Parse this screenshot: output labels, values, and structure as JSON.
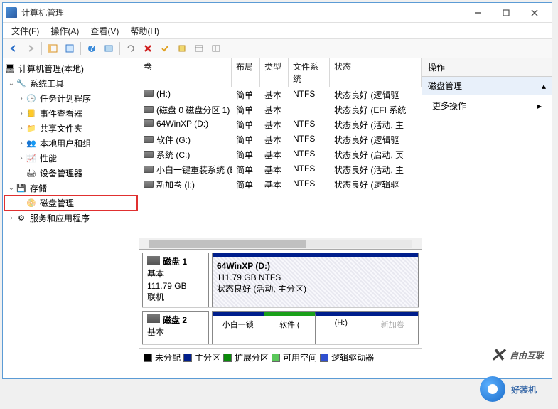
{
  "window": {
    "title": "计算机管理"
  },
  "menu": {
    "file": "文件(F)",
    "action": "操作(A)",
    "view": "查看(V)",
    "help": "帮助(H)"
  },
  "tree": {
    "root": "计算机管理(本地)",
    "sys_tools": "系统工具",
    "task_sched": "任务计划程序",
    "event_viewer": "事件查看器",
    "shared_folders": "共享文件夹",
    "local_users": "本地用户和组",
    "performance": "性能",
    "device_mgr": "设备管理器",
    "storage": "存储",
    "disk_mgmt": "磁盘管理",
    "services": "服务和应用程序"
  },
  "vol_header": {
    "vol": "卷",
    "layout": "布局",
    "type": "类型",
    "fs": "文件系统",
    "status": "状态"
  },
  "volumes": [
    {
      "name": "(H:)",
      "layout": "简单",
      "type": "基本",
      "fs": "NTFS",
      "status": "状态良好 (逻辑驱"
    },
    {
      "name": "(磁盘 0 磁盘分区 1)",
      "layout": "简单",
      "type": "基本",
      "fs": "",
      "status": "状态良好 (EFI 系统"
    },
    {
      "name": "64WinXP  (D:)",
      "layout": "简单",
      "type": "基本",
      "fs": "NTFS",
      "status": "状态良好 (活动, 主"
    },
    {
      "name": "软件 (G:)",
      "layout": "简单",
      "type": "基本",
      "fs": "NTFS",
      "status": "状态良好 (逻辑驱"
    },
    {
      "name": "系统 (C:)",
      "layout": "简单",
      "type": "基本",
      "fs": "NTFS",
      "status": "状态良好 (启动, 页"
    },
    {
      "name": "小白一键重装系统 (E:)",
      "layout": "简单",
      "type": "基本",
      "fs": "NTFS",
      "status": "状态良好 (活动, 主"
    },
    {
      "name": "新加卷 (I:)",
      "layout": "简单",
      "type": "基本",
      "fs": "NTFS",
      "status": "状态良好 (逻辑驱"
    }
  ],
  "disk1": {
    "title": "磁盘 1",
    "type": "基本",
    "size": "111.79 GB",
    "state": "联机",
    "part_name": "64WinXP   (D:)",
    "part_size": "111.79 GB NTFS",
    "part_status": "状态良好 (活动, 主分区)"
  },
  "disk2": {
    "title": "磁盘 2",
    "type": "基本",
    "segs": [
      "小白一锁",
      "软件 (",
      "(H:)",
      "新加卷"
    ]
  },
  "legend": {
    "unalloc": "未分配",
    "primary": "主分区",
    "ext": "扩展分区",
    "free": "可用空间",
    "logical": "逻辑驱动器"
  },
  "actions": {
    "header": "操作",
    "section": "磁盘管理",
    "more": "更多操作"
  },
  "watermark1": "自由互联",
  "watermark2": "好装机"
}
